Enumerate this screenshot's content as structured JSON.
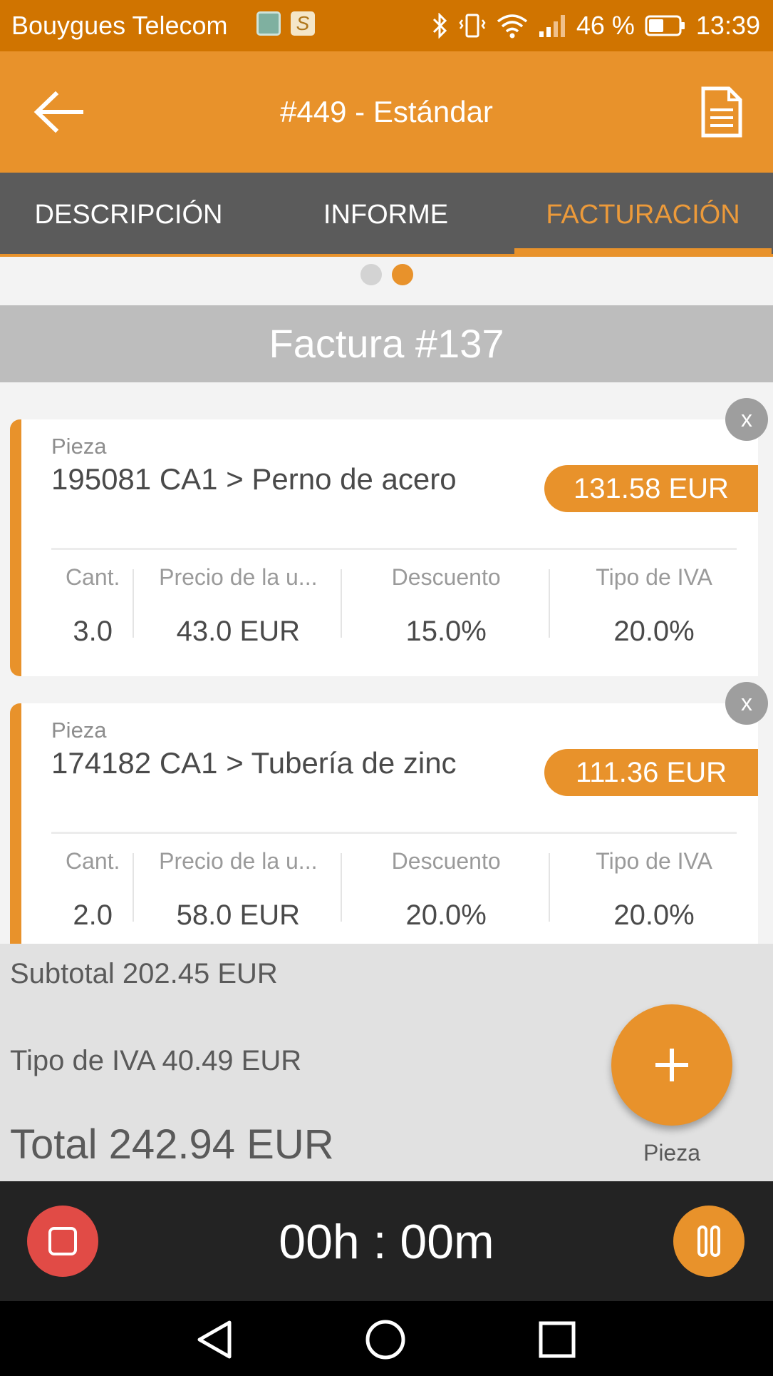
{
  "status_bar": {
    "carrier": "Bouygues Telecom",
    "battery": "46 %",
    "time": "13:39",
    "icons": [
      "gallery-icon",
      "app-s-icon",
      "bluetooth-icon",
      "vibrate-icon",
      "wifi-icon",
      "signal-icon",
      "battery-icon"
    ]
  },
  "app_bar": {
    "title": "#449 - Estándar",
    "back_icon": "arrow-left-icon",
    "action_icon": "document-icon"
  },
  "tabs": [
    {
      "label": "DESCRIPCIÓN",
      "active": false
    },
    {
      "label": "INFORME",
      "active": false
    },
    {
      "label": "FACTURACIÓN",
      "active": true
    }
  ],
  "pager": {
    "count": 2,
    "active_index": 1
  },
  "invoice": {
    "title": "Factura #137",
    "items": [
      {
        "category": "Pieza",
        "name": "195081 CA1 > Perno de acero",
        "price": "131.58 EUR",
        "remove_label": "x",
        "fields": [
          {
            "label": "Cant.",
            "value": "3.0"
          },
          {
            "label": "Precio de la u...",
            "value": "43.0 EUR"
          },
          {
            "label": "Descuento",
            "value": "15.0%"
          },
          {
            "label": "Tipo de IVA",
            "value": "20.0%"
          }
        ]
      },
      {
        "category": "Pieza",
        "name": "174182 CA1 > Tubería de zinc",
        "price": "111.36 EUR",
        "remove_label": "x",
        "fields": [
          {
            "label": "Cant.",
            "value": "2.0"
          },
          {
            "label": "Precio de la u...",
            "value": "58.0 EUR"
          },
          {
            "label": "Descuento",
            "value": "20.0%"
          },
          {
            "label": "Tipo de IVA",
            "value": "20.0%"
          }
        ]
      }
    ]
  },
  "totals": {
    "subtotal": "Subtotal 202.45 EUR",
    "iva": "Tipo de IVA 40.49 EUR",
    "total": "Total 242.94 EUR"
  },
  "fab": {
    "icon": "plus-icon",
    "label": "Pieza"
  },
  "timer": {
    "value": "00h : 00m",
    "stop_icon": "stop-icon",
    "pause_icon": "pause-icon"
  },
  "colors": {
    "accent": "#e8922b",
    "status_bar": "#d07400",
    "tab_bar": "#5b5b5b",
    "stop": "#e14b46"
  }
}
